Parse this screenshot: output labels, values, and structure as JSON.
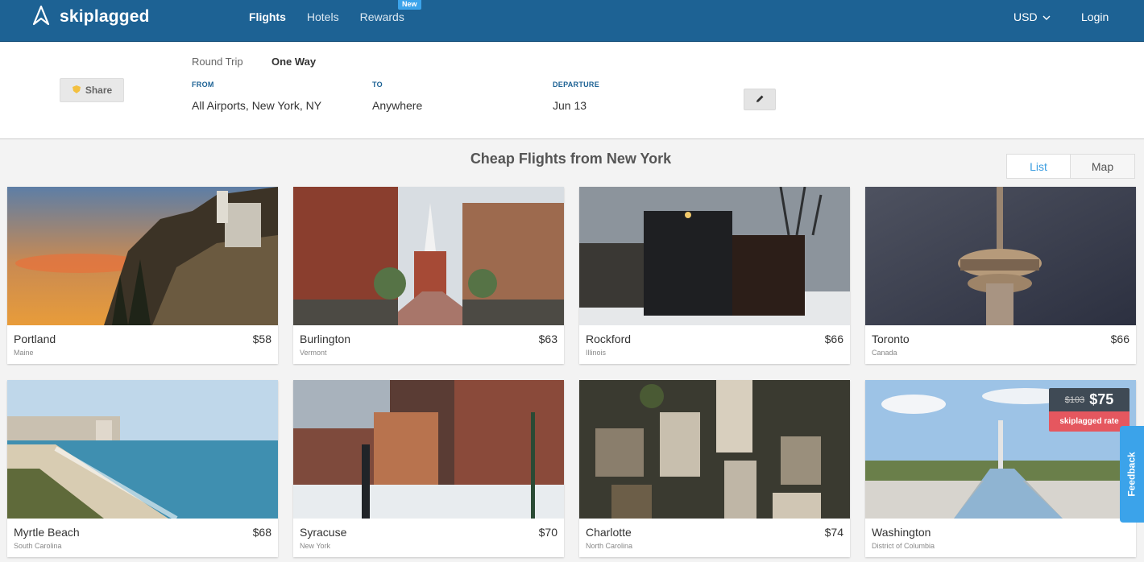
{
  "header": {
    "logo_text": "skiplagged",
    "nav": [
      {
        "label": "Flights"
      },
      {
        "label": "Hotels"
      },
      {
        "label": "Rewards"
      }
    ],
    "rewards_badge": "New",
    "currency": "USD",
    "login": "Login"
  },
  "search": {
    "share_label": "Share",
    "trip_types": [
      "Round Trip",
      "One Way"
    ],
    "selected_trip_type": "One Way",
    "from_label": "FROM",
    "from_value": "All Airports, New York, NY",
    "to_label": "TO",
    "to_value": "Anywhere",
    "departure_label": "DEPARTURE",
    "departure_value": "Jun 13"
  },
  "main": {
    "title": "Cheap Flights from New York",
    "view_options": [
      "List",
      "Map"
    ],
    "selected_view": "List"
  },
  "destinations": [
    {
      "city": "Portland",
      "region": "Maine",
      "price": "$58"
    },
    {
      "city": "Burlington",
      "region": "Vermont",
      "price": "$63"
    },
    {
      "city": "Rockford",
      "region": "Illinois",
      "price": "$66"
    },
    {
      "city": "Toronto",
      "region": "Canada",
      "price": "$66"
    },
    {
      "city": "Myrtle Beach",
      "region": "South Carolina",
      "price": "$68"
    },
    {
      "city": "Syracuse",
      "region": "New York",
      "price": "$70"
    },
    {
      "city": "Charlotte",
      "region": "North Carolina",
      "price": "$74"
    },
    {
      "city": "Washington",
      "region": "District of Columbia",
      "price": "",
      "deal": {
        "old_price": "$103",
        "new_price": "$75",
        "tag": "skiplagged rate"
      }
    }
  ],
  "feedback_label": "Feedback",
  "colors": {
    "header_bg": "#1d6294",
    "accent": "#3ba3ea",
    "deal_red": "#e5575f"
  }
}
